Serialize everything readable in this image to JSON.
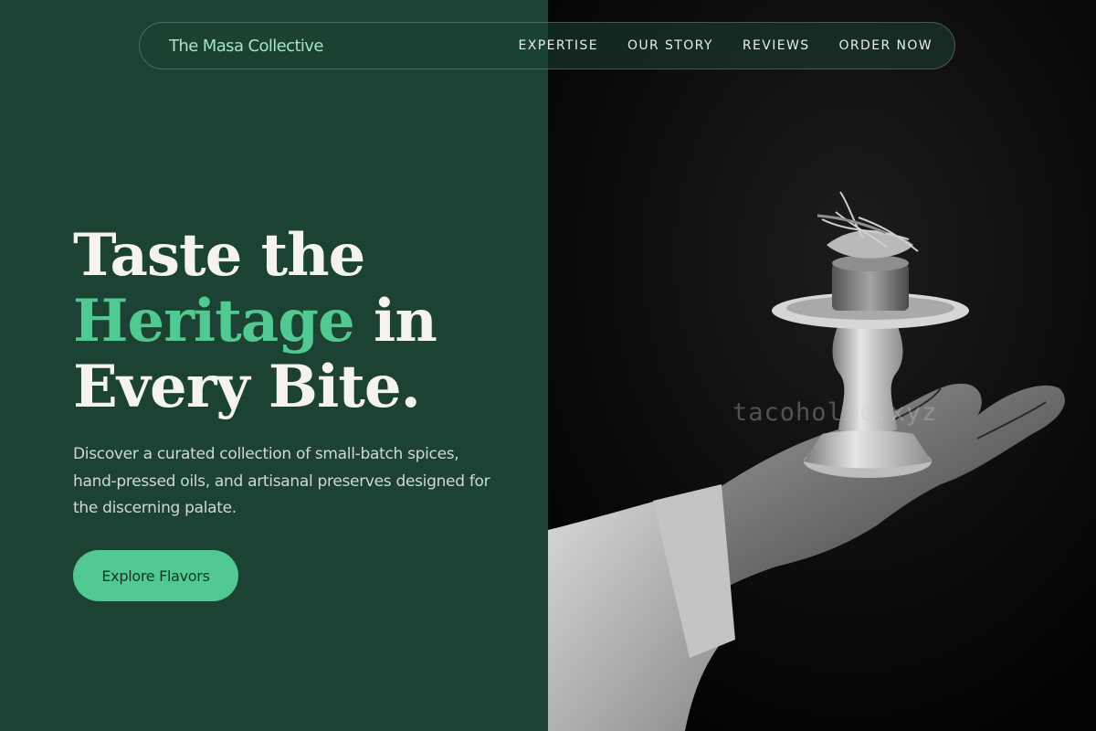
{
  "nav": {
    "brand": "The Masa Collective",
    "links": [
      {
        "label": "EXPERTISE"
      },
      {
        "label": "OUR STORY"
      },
      {
        "label": "REVIEWS"
      },
      {
        "label": "ORDER NOW"
      }
    ]
  },
  "hero": {
    "headline_part1": "Taste the",
    "headline_accent": "Heritage",
    "headline_part2": " in",
    "headline_part3": "Every Bite.",
    "description": "Discover a curated collection of small-batch spices, hand-pressed oils, and artisanal preserves designed for the discerning palate.",
    "cta_label": "Explore Flavors"
  },
  "image": {
    "watermark": "tacoholic.xyz"
  },
  "colors": {
    "background": "#1c4233",
    "accent": "#52c993",
    "brand_text": "#a8e3c4",
    "headline": "#f4f3ee"
  }
}
